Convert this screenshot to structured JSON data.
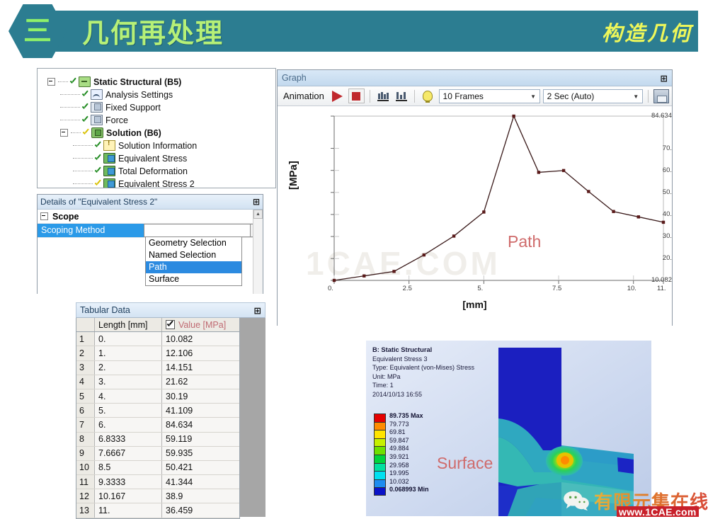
{
  "header": {
    "badge": "三",
    "title": "几何再处理",
    "right_title": "构造几何",
    "bar_color": "#2c7d91",
    "title_color": "#b6f077",
    "right_color": "#eef75a"
  },
  "tree": {
    "items": [
      {
        "label": "Static Structural (B5)",
        "icon": "folder-icon",
        "bold": true,
        "indent": 0,
        "check": "green",
        "expander": true
      },
      {
        "label": "Analysis Settings",
        "icon": "gear-icon",
        "bold": false,
        "indent": 1,
        "check": "green",
        "expander": false
      },
      {
        "label": "Fixed Support",
        "icon": "cube-icon",
        "bold": false,
        "indent": 1,
        "check": "green",
        "expander": false
      },
      {
        "label": "Force",
        "icon": "cube-icon",
        "bold": false,
        "indent": 1,
        "check": "green",
        "expander": false
      },
      {
        "label": "Solution (B6)",
        "icon": "solution-icon",
        "bold": true,
        "indent": 1,
        "check": "bolt",
        "expander": true
      },
      {
        "label": "Solution Information",
        "icon": "info-icon",
        "bold": false,
        "indent": 2,
        "check": "green",
        "expander": false
      },
      {
        "label": "Equivalent Stress",
        "icon": "result-icon",
        "bold": false,
        "indent": 2,
        "check": "green",
        "expander": false
      },
      {
        "label": "Total Deformation",
        "icon": "result-icon",
        "bold": false,
        "indent": 2,
        "check": "green",
        "expander": false
      },
      {
        "label": "Equivalent Stress 2",
        "icon": "result-icon",
        "bold": false,
        "indent": 2,
        "check": "bolt",
        "expander": false
      }
    ]
  },
  "details": {
    "title": "Details of \"Equivalent Stress 2\"",
    "pin": "⊞",
    "group_label": "Scope",
    "property_label": "Scoping Method",
    "property_value": "",
    "dropdown_arrow": "▼",
    "dropdown_options": [
      "Geometry Selection",
      "Named Selection",
      "Path",
      "Surface"
    ],
    "dropdown_selected": "Path",
    "scroll_up": "▲",
    "highlight_color": "#2b9ae8"
  },
  "tabular": {
    "title": "Tabular Data",
    "pin": "⊞",
    "columns": [
      "",
      "Length [mm]",
      "Value [MPa]"
    ],
    "value_header_checked": true,
    "rows": [
      {
        "idx": "1",
        "length": "0.",
        "value": "10.082"
      },
      {
        "idx": "2",
        "length": "1.",
        "value": "12.106"
      },
      {
        "idx": "3",
        "length": "2.",
        "value": "14.151"
      },
      {
        "idx": "4",
        "length": "3.",
        "value": "21.62"
      },
      {
        "idx": "5",
        "length": "4.",
        "value": "30.19"
      },
      {
        "idx": "6",
        "length": "5.",
        "value": "41.109"
      },
      {
        "idx": "7",
        "length": "6.",
        "value": "84.634"
      },
      {
        "idx": "8",
        "length": "6.8333",
        "value": "59.119"
      },
      {
        "idx": "9",
        "length": "7.6667",
        "value": "59.935"
      },
      {
        "idx": "10",
        "length": "8.5",
        "value": "50.421"
      },
      {
        "idx": "11",
        "length": "9.3333",
        "value": "41.344"
      },
      {
        "idx": "12",
        "length": "10.167",
        "value": "38.9"
      },
      {
        "idx": "13",
        "length": "11.",
        "value": "36.459"
      }
    ]
  },
  "graph": {
    "title": "Graph",
    "pin": "⊞",
    "toolbar": {
      "animation_label": "Animation",
      "play_icon": "play-icon",
      "stop_icon": "stop-icon",
      "distribute_icon": "distribute-bars-icon",
      "distribute2_icon": "distribute-bars-alt-icon",
      "bulb_icon": "lightbulb-icon",
      "frames_value": "10 Frames",
      "frames_arrow": "▼",
      "time_value": "2 Sec (Auto)",
      "time_arrow": "▼",
      "export_icon": "export-video-icon"
    },
    "watermark": "1CAE.COM",
    "path_label": "Path"
  },
  "chart_data": {
    "type": "line",
    "title": "",
    "xlabel": "[mm]",
    "ylabel": "[MPa]",
    "xlim": [
      0,
      11
    ],
    "ylim": [
      10.082,
      84.634
    ],
    "xticks": [
      "0.",
      "2.5",
      "5.",
      "7.5",
      "10.",
      "11."
    ],
    "xtick_values": [
      0,
      2.5,
      5,
      7.5,
      10,
      11
    ],
    "yticks": [
      "10.082",
      "20.",
      "30.",
      "40.",
      "50.",
      "60.",
      "70.",
      "84.634"
    ],
    "ytick_values": [
      10.082,
      20,
      30,
      40,
      50,
      60,
      70,
      84.634
    ],
    "grid": false,
    "legend": "none",
    "line_color": "#3a1a1a",
    "marker_color": "#5a1a1a",
    "x": [
      0,
      1,
      2,
      3,
      4,
      5,
      6,
      6.8333,
      7.6667,
      8.5,
      9.3333,
      10.167,
      11
    ],
    "values": [
      10.082,
      12.106,
      14.151,
      21.62,
      30.19,
      41.109,
      84.634,
      59.119,
      59.935,
      50.421,
      41.344,
      38.9,
      36.459
    ],
    "series": [
      {
        "name": "Equivalent Stress 2",
        "values": [
          10.082,
          12.106,
          14.151,
          21.62,
          30.19,
          41.109,
          84.634,
          59.119,
          59.935,
          50.421,
          41.344,
          38.9,
          36.459
        ]
      }
    ]
  },
  "contour": {
    "header_line1": "B: Static Structural",
    "header_line2": "Equivalent Stress 3",
    "header_line3": "Type: Equivalent (von-Mises) Stress",
    "header_line4": "Unit: MPa",
    "header_line5": "Time: 1",
    "header_line6": "2014/10/13 16:55",
    "surface_label": "Surface",
    "legend": [
      {
        "value": "89.735 Max",
        "color": "#e50000"
      },
      {
        "value": "79.773",
        "color": "#ff8c00"
      },
      {
        "value": "69.81",
        "color": "#ffe400"
      },
      {
        "value": "59.847",
        "color": "#c6f000"
      },
      {
        "value": "49.884",
        "color": "#6ee000"
      },
      {
        "value": "39.921",
        "color": "#00d43c"
      },
      {
        "value": "29.958",
        "color": "#00e0a0"
      },
      {
        "value": "19.995",
        "color": "#00e0f0"
      },
      {
        "value": "10.032",
        "color": "#1d8cf0"
      },
      {
        "value": "0.068993 Min",
        "color": "#0a12c8"
      }
    ]
  },
  "watermark": {
    "wechat_icon": "wechat-icon",
    "text": "有限元集在线",
    "url": "www.1CAE.com"
  }
}
